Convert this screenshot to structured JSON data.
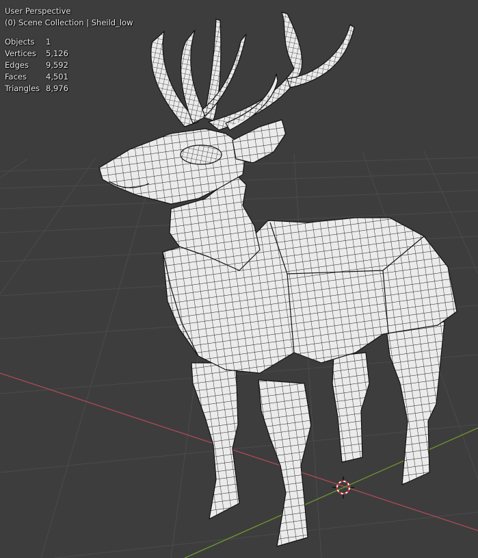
{
  "viewport": {
    "view_name": "User Perspective",
    "collection_line": "(0) Scene Collection | Sheild_low"
  },
  "stats": [
    {
      "label": "Objects",
      "value": "1"
    },
    {
      "label": "Vertices",
      "value": "5,126"
    },
    {
      "label": "Edges",
      "value": "9,592"
    },
    {
      "label": "Faces",
      "value": "4,501"
    },
    {
      "label": "Triangles",
      "value": "8,976"
    }
  ],
  "colors": {
    "background": "#3d3d3d",
    "grid": "#4a4a4a",
    "x_axis": "#b04a55",
    "y_axis": "#6e9a2e",
    "mesh_fill": "#ebebeb",
    "wire": "#1a1a1a"
  },
  "icons": {
    "cursor": "3d-cursor-icon",
    "model": "deer-mesh-model"
  }
}
